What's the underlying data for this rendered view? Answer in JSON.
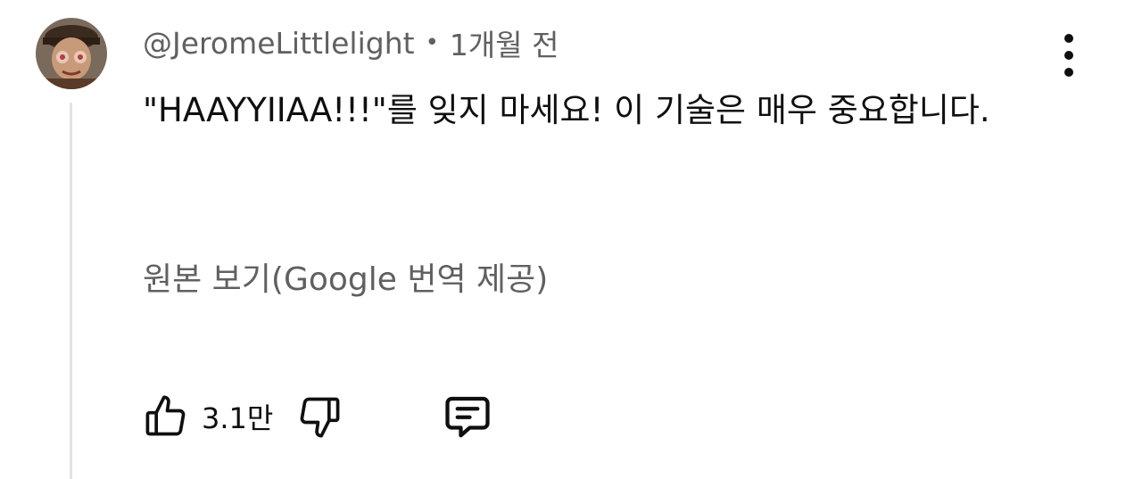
{
  "comment": {
    "author": "@JeromeLittlelight",
    "separator": "•",
    "timestamp": "1개월 전",
    "text": "\"HAAYYIIAA!!!\"를 잊지 마세요! 이 기술은 매우 중요합니다.",
    "translation_link": "원본 보기(Google 번역 제공)"
  },
  "actions": {
    "like_count": "3.1만",
    "like_icon": "thumbs-up-icon",
    "dislike_icon": "thumbs-down-icon",
    "reply_icon": "comment-icon",
    "more_icon": "more-vertical-icon"
  },
  "colors": {
    "primary_text": "#0f0f0f",
    "secondary_text": "#606060",
    "thread_line": "#e3e3e3",
    "background": "#ffffff"
  }
}
